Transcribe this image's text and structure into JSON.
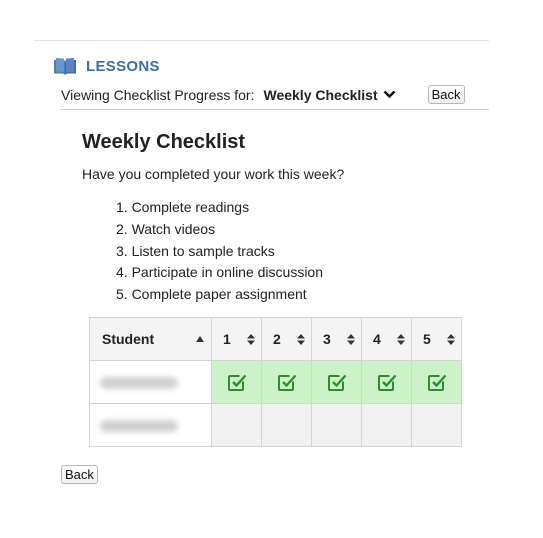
{
  "header": {
    "section_icon": "book-icon",
    "section_label": "LESSONS",
    "viewing_label": "Viewing Checklist Progress for:",
    "checklist_select": "Weekly Checklist",
    "back_label": "Back"
  },
  "checklist": {
    "title": "Weekly Checklist",
    "question": "Have you completed your work this week?",
    "tasks": [
      "1. Complete readings",
      "2. Watch videos",
      "3. Listen to sample tracks",
      "4. Participate in online discussion",
      "5. Complete paper assignment"
    ]
  },
  "table": {
    "columns": [
      "Student",
      "1",
      "2",
      "3",
      "4",
      "5"
    ],
    "rows": [
      {
        "student": "[name obscured]",
        "completed": [
          true,
          true,
          true,
          true,
          true
        ]
      },
      {
        "student": "[name obscured]",
        "completed": [
          false,
          false,
          false,
          false,
          false
        ]
      }
    ],
    "completed_color": "#ccf2c7",
    "check_color": "#2e8b2e"
  },
  "footer": {
    "back_label": "Back"
  }
}
